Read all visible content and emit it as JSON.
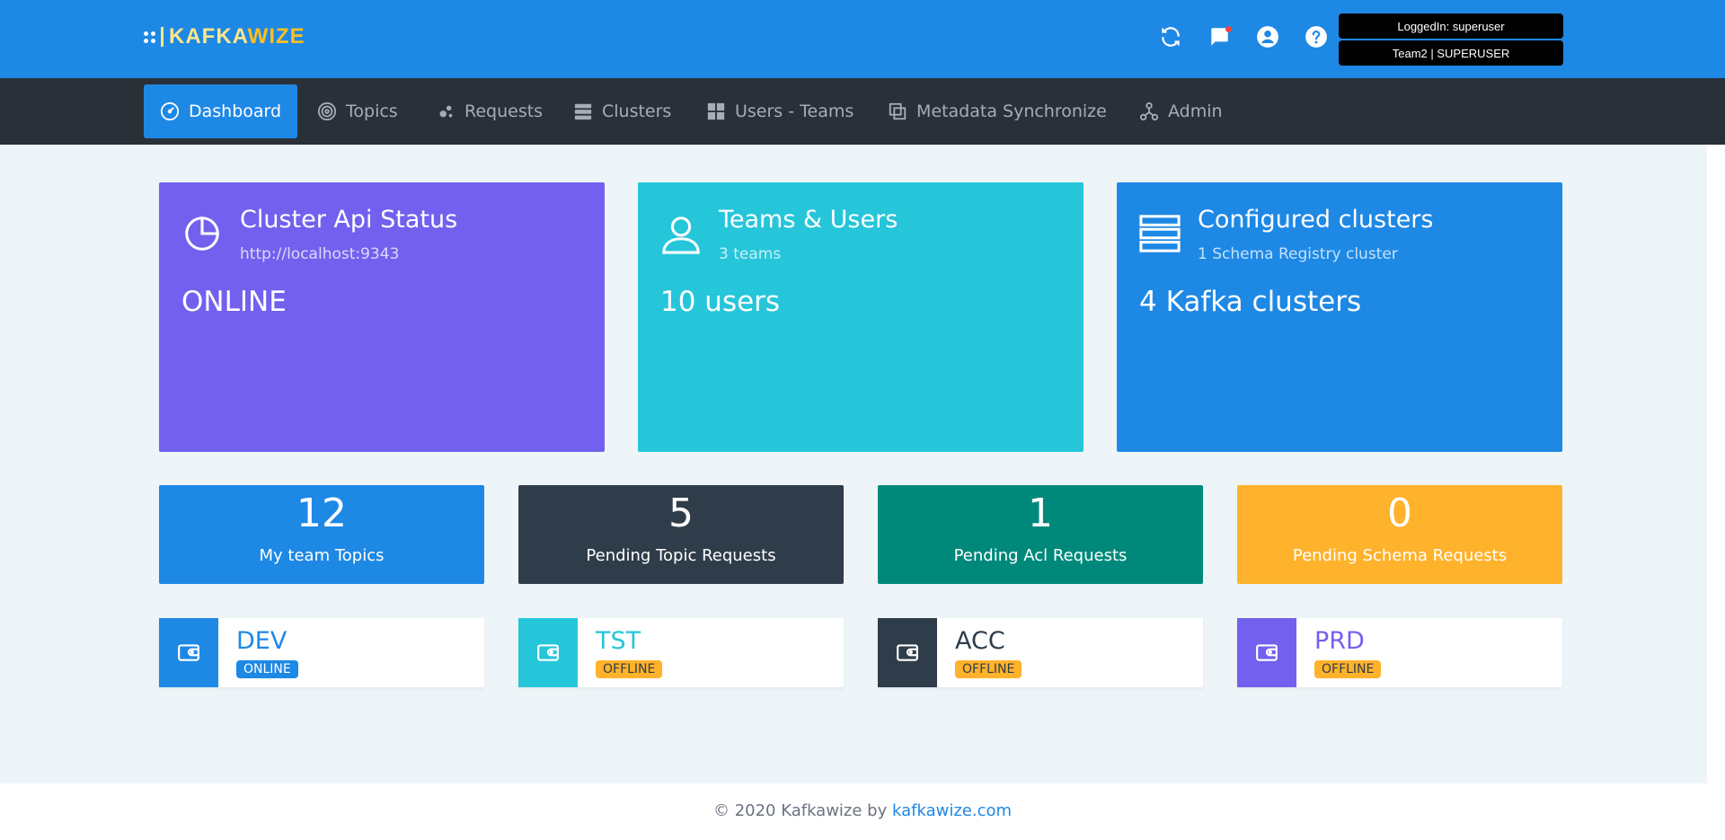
{
  "brand": {
    "name_part1": "KAFKA",
    "name_part2": "WIZE"
  },
  "header": {
    "user_login": "LoggedIn: superuser",
    "user_team": "Team2 | SUPERUSER"
  },
  "nav": {
    "items": [
      {
        "label": "Dashboard",
        "icon": "dashboard-icon",
        "active": true
      },
      {
        "label": "Topics",
        "icon": "target-icon"
      },
      {
        "label": "Requests",
        "icon": "requests-icon"
      },
      {
        "label": "Clusters",
        "icon": "server-icon"
      },
      {
        "label": "Users - Teams",
        "icon": "users-teams-icon"
      },
      {
        "label": "Metadata Synchronize",
        "icon": "copy-icon"
      },
      {
        "label": "Admin",
        "icon": "admin-icon"
      }
    ]
  },
  "cards": {
    "cluster_api": {
      "title": "Cluster Api Status",
      "subtitle": "http://localhost:9343",
      "value": "ONLINE",
      "color": "#7460ee"
    },
    "teams_users": {
      "title": "Teams & Users",
      "subtitle": "3 teams",
      "value": "10 users",
      "color": "#26c6da"
    },
    "clusters": {
      "title": "Configured clusters",
      "subtitle": "1 Schema Registry cluster",
      "value": "4 Kafka clusters",
      "color": "#1e88e5"
    }
  },
  "stats": [
    {
      "number": "12",
      "label": "My team Topics",
      "color": "#1e88e5"
    },
    {
      "number": "5",
      "label": "Pending Topic Requests",
      "color": "#2f3d4a"
    },
    {
      "number": "1",
      "label": "Pending Acl Requests",
      "color": "#00897b"
    },
    {
      "number": "0",
      "label": "Pending Schema Requests",
      "color": "#ffb22b"
    }
  ],
  "envs": [
    {
      "name": "DEV",
      "status": "ONLINE",
      "box_color": "#1e88e5",
      "name_color": "#1e88e5",
      "status_color": "#1e88e5"
    },
    {
      "name": "TST",
      "status": "OFFLINE",
      "box_color": "#26c6da",
      "name_color": "#26c6da",
      "status_color": "#ffb22b"
    },
    {
      "name": "ACC",
      "status": "OFFLINE",
      "box_color": "#2f3d4a",
      "name_color": "#2f3d4a",
      "status_color": "#ffb22b"
    },
    {
      "name": "PRD",
      "status": "OFFLINE",
      "box_color": "#7460ee",
      "name_color": "#7460ee",
      "status_color": "#ffb22b"
    }
  ],
  "footer": {
    "text": "© 2020 Kafkawize by ",
    "link": "kafkawize.com"
  }
}
